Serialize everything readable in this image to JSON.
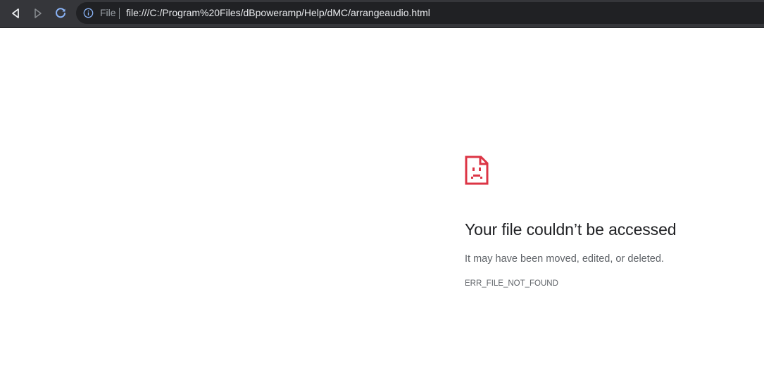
{
  "toolbar": {
    "back_icon": "back-arrow-icon",
    "forward_icon": "forward-arrow-icon",
    "reload_icon": "reload-icon"
  },
  "omnibox": {
    "security_icon": "info-icon",
    "chip_label": "File",
    "url": "file:///C:/Program%20Files/dBpoweramp/Help/dMC/arrangeaudio.html"
  },
  "error": {
    "icon": "sad-file-icon",
    "icon_color": "#dc3545",
    "title": "Your file couldn’t be accessed",
    "description": "It may have been moved, edited, or deleted.",
    "code": "ERR_FILE_NOT_FOUND"
  },
  "colors": {
    "toolbar_bg": "#35363a",
    "omnibox_bg": "#202124",
    "reload_accent": "#8ab4f8",
    "page_bg": "#ffffff"
  }
}
